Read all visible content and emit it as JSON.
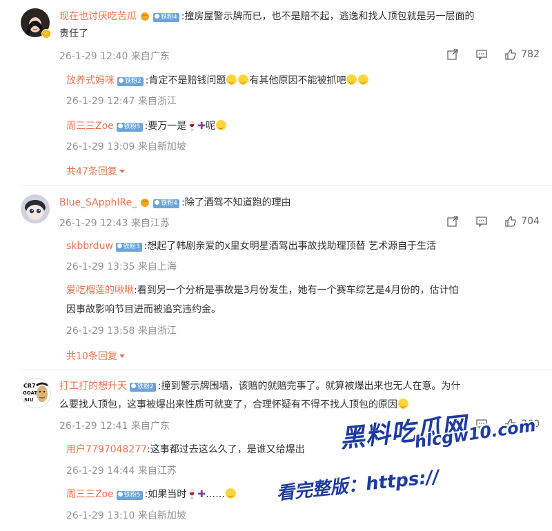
{
  "comments": [
    {
      "user": "现在也讨厌吃苦瓜",
      "fan_badge": "铁粉4",
      "text_line1": ":撞房屋警示牌而已，也不是赔不起，逃逸和找人顶包就是另一层面的",
      "text_line2": "责任了",
      "time": "26-1-29 12:40 来自广东",
      "likes": "782",
      "replies": [
        {
          "user": "放养式妈咪",
          "fan_badge": "铁粉2",
          "text": ":肯定不是赔钱问题",
          "text2": "有其他原因不能被抓吧",
          "time": "26-1-29 12:47 来自浙江"
        },
        {
          "user": "周三三Zoe",
          "fan_badge": "铁粉5",
          "text": ":要万一是",
          "text2": "呢",
          "time": "26-1-29 13:09 来自新加坡"
        }
      ],
      "more": "共47条回复"
    },
    {
      "user": "Blue_SApphIRe_",
      "fan_badge": "铁粉4",
      "text_line1": ":除了酒驾不知道跑的理由",
      "time": "26-1-29 12:43 来自江苏",
      "likes": "704",
      "replies": [
        {
          "user": "skbbrduw",
          "fan_badge": "铁粉3",
          "text": ":想起了韩剧亲爱的x里女明星酒驾出事故找助理顶替 艺术源自于生活",
          "time": "26-1-29 13:35 来自上海"
        },
        {
          "user": "爱吃榴莲的啾啾",
          "text": ":看到另一个分析是事故是3月份发生，她有一个赛车综艺是4月份的，估计怕",
          "text2": "因事故影响节目进而被追究违约金。",
          "time": "26-1-29 13:58 来自浙江"
        }
      ],
      "more": "共10条回复"
    },
    {
      "user": "打工打的想升天",
      "fan_badge": "铁粉2",
      "text_line1": ":撞到警示牌围墙，该赔的就赔完事了。就算被爆出来也无人在意。为什",
      "text_line2": "么要找人顶包，这事被爆出来性质可就变了，合理怀疑有不得不找人顶包的原因",
      "avatar_text": "CR7 GOAT SIU",
      "time": "26-1-29 12:41 来自广东",
      "likes": "360",
      "replies": [
        {
          "user": "用户7797048277",
          "text": ":这事都过去这么久了，是谁又给爆出",
          "time": "26-1-29 14:44 来自江苏"
        },
        {
          "user": "周三三Zoe",
          "fan_badge": "铁粉5",
          "text": ":如果当时",
          "text2": "……",
          "time": "26-1-29 13:10 来自新加坡"
        }
      ]
    }
  ],
  "watermark": {
    "line1": "黑料吃瓜网",
    "line2": "hlcgw10.com",
    "line3": "看完整版：https://"
  },
  "colors": {
    "username": "#eb7350",
    "meta": "#939393",
    "badge": "#6ba4dc",
    "watermark": "#1e3c9f"
  },
  "icons": [
    "share-icon",
    "comment-icon",
    "like-icon",
    "wine-glass-emoji",
    "plus-emoji",
    "smile-emoji",
    "crown-icon",
    "caret-down-icon"
  ]
}
